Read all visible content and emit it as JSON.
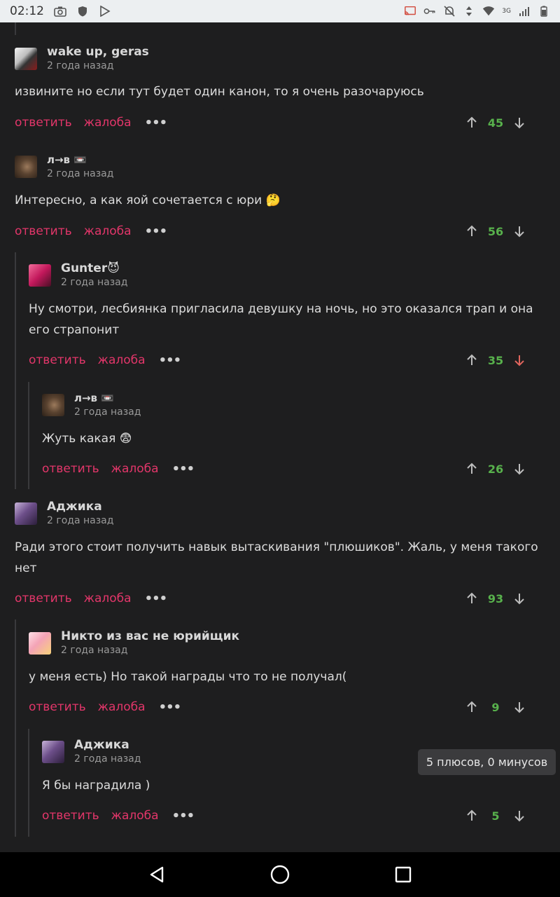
{
  "status_bar": {
    "time": "02:12",
    "network": "3G"
  },
  "labels": {
    "reply": "ответить",
    "report": "жалоба",
    "more": "•••"
  },
  "colors": {
    "accent": "#e3366a",
    "score": "#58b14c",
    "downvoted": "#e0655d",
    "background": "#1e1e1f"
  },
  "comments": [
    {
      "author": "wake up, geras",
      "time": "2 года назад",
      "text": "извините но если тут будет один канон, то я очень разочаруюсь",
      "score": "45",
      "downvoted": false
    },
    {
      "author": "л→в 📼",
      "time": "2 года назад",
      "text": "Интересно, а как яой сочетается с юри 🤔",
      "score": "56",
      "downvoted": false
    },
    {
      "author": "Gunter😈",
      "time": "2 года назад",
      "text": "Ну смотри, лесбиянка пригласила девушку на ночь, но это оказался трап и она его страпонит",
      "score": "35",
      "downvoted": true
    },
    {
      "author": "л→в 📼",
      "time": "2 года назад",
      "text": "Жуть какая 😨",
      "score": "26",
      "downvoted": false
    },
    {
      "author": "Аджика",
      "time": "2 года назад",
      "text": "Ради этого стоит получить навык вытаскивания \"плюшиков\". Жаль, у меня такого нет",
      "score": "93",
      "downvoted": false
    },
    {
      "author": "Никто из вас не юрийщик",
      "time": "2 года назад",
      "text": "у меня есть) Но такой награды что то не получал(",
      "score": "9",
      "downvoted": false
    },
    {
      "author": "Аджика",
      "time": "2 года назад",
      "text": "Я бы наградила )",
      "score": "5",
      "downvoted": false
    }
  ],
  "tooltip": "5 плюсов, 0 минусов"
}
